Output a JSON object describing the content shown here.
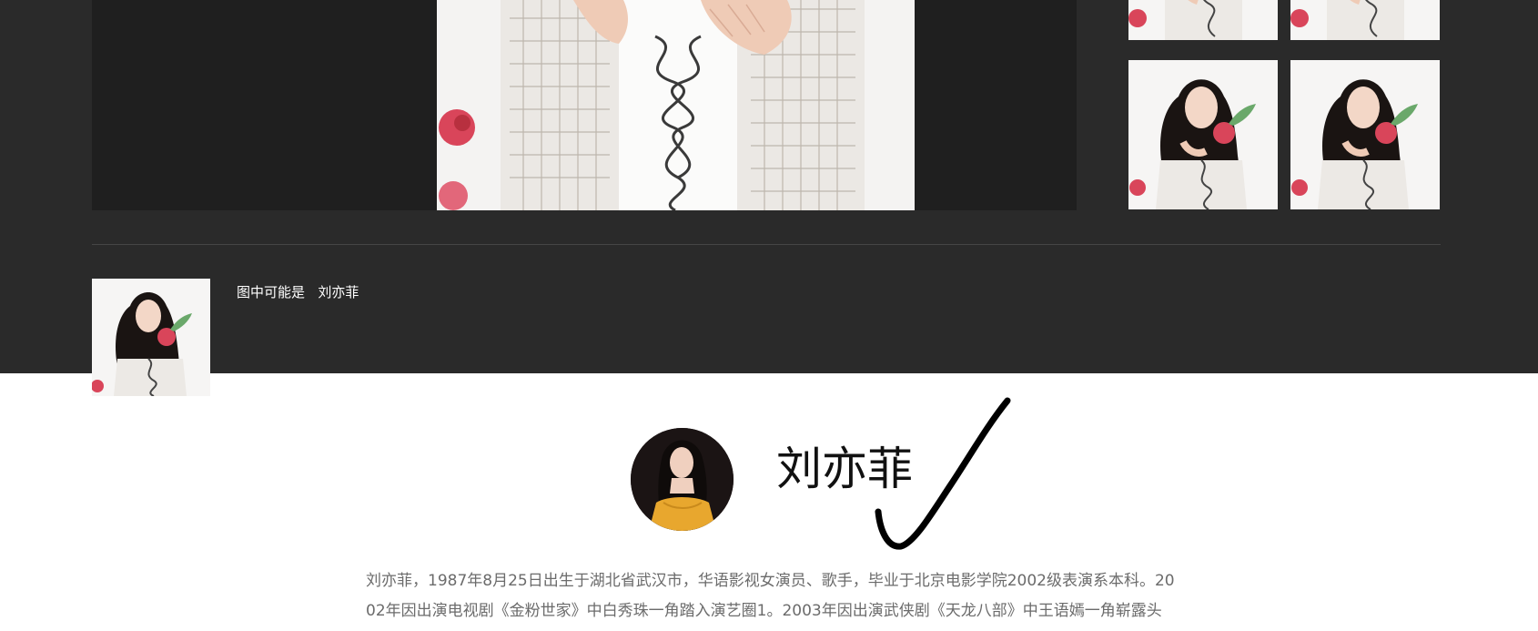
{
  "caption": {
    "prefix": "图中可能是",
    "person": "刘亦菲"
  },
  "profile": {
    "name": "刘亦菲"
  },
  "bio": {
    "line1": "刘亦菲，1987年8月25日出生于湖北省武汉市，华语影视女演员、歌手，毕业于北京电影学院2002级表演系本科。20",
    "line2": "02年因出演电视剧《金粉世家》中白秀珠一角踏入演艺圈1。2003年因出演武侠剧《天龙八部》中王语嫣一角崭露头"
  },
  "icons": {
    "annotation": "checkmark-stroke"
  },
  "colors": {
    "dark_background": "#2a2a2a",
    "viewer_background": "#1f1f1f",
    "photo_background": "#f4f3f2",
    "rose": "#d9455a",
    "leaf": "#6aa86a",
    "hair": "#1a1412",
    "avatar_dress": "#e8a72e"
  }
}
